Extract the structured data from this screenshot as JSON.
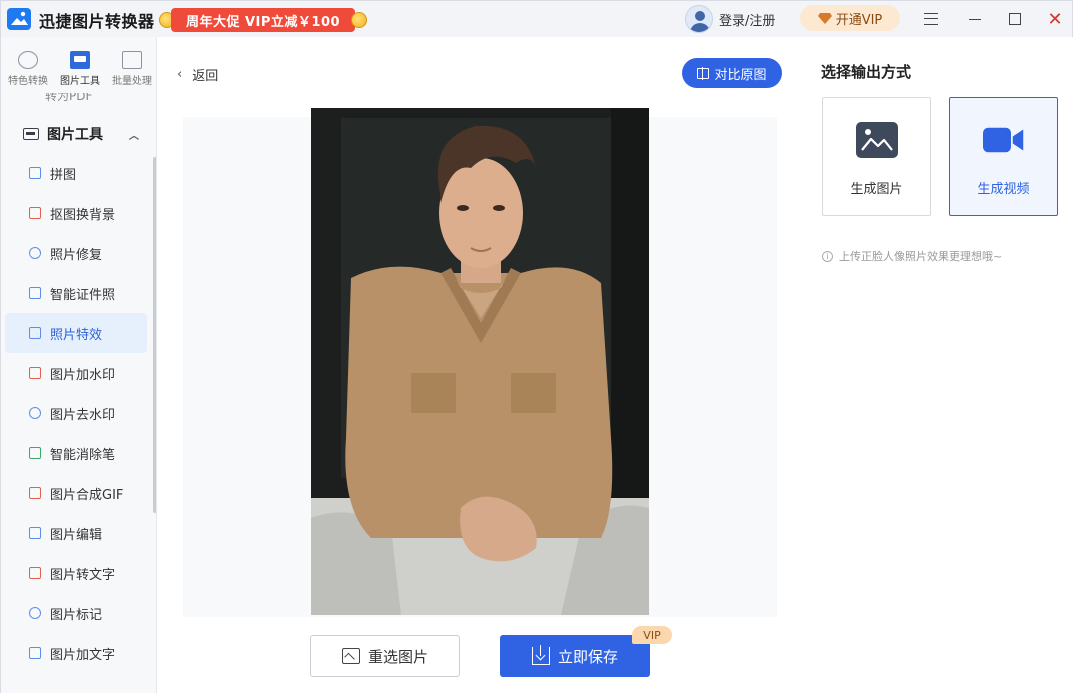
{
  "app": {
    "title": "迅捷图片转换器",
    "promo": "周年大促 VIP立减￥100",
    "login": "登录/注册",
    "vip": "开通VIP"
  },
  "sidebar": {
    "top_tabs": [
      {
        "label": "特色转换",
        "icon": "feature-convert-icon"
      },
      {
        "label": "图片工具",
        "icon": "image-tools-icon"
      },
      {
        "label": "批量处理",
        "icon": "batch-process-icon"
      }
    ],
    "cutoff_item": "转为PDF",
    "group": "图片工具",
    "items": [
      {
        "label": "拼图"
      },
      {
        "label": "抠图换背景"
      },
      {
        "label": "照片修复"
      },
      {
        "label": "智能证件照"
      },
      {
        "label": "照片特效"
      },
      {
        "label": "图片加水印"
      },
      {
        "label": "图片去水印"
      },
      {
        "label": "智能消除笔"
      },
      {
        "label": "图片合成GIF"
      },
      {
        "label": "图片编辑"
      },
      {
        "label": "图片转文字"
      },
      {
        "label": "图片标记"
      },
      {
        "label": "图片加文字"
      }
    ]
  },
  "main": {
    "back": "返回",
    "compare": "对比原图",
    "reselect": "重选图片",
    "save": "立即保存",
    "save_badge": "VIP"
  },
  "right": {
    "title": "选择输出方式",
    "options": [
      {
        "label": "生成图片",
        "icon": "image-icon"
      },
      {
        "label": "生成视频",
        "icon": "video-camera-icon"
      }
    ],
    "tip": "上传正脸人像照片效果更理想哦~"
  },
  "colors": {
    "accent": "#2f63e4",
    "promo": "#f04b3a",
    "vip_bg": "#fde9d2"
  }
}
